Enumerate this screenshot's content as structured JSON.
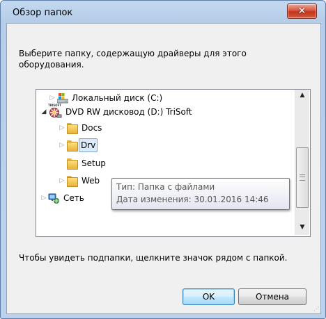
{
  "dialog": {
    "title": "Обзор папок",
    "close_glyph": "✕",
    "prompt": "Выберите папку, содержащую драйверы для этого оборудования.",
    "hint": "Чтобы увидеть подпапки, щелкните значок рядом с папкой.",
    "ok_label": "OK",
    "cancel_label": "Отмена"
  },
  "tree": {
    "items": [
      {
        "label": "Локальный диск (C:)",
        "icon": "hard-drive-icon",
        "expander": "collapsed"
      },
      {
        "label": "DVD RW дисковод (D:) TriSoft",
        "icon": "dvd-drive-icon",
        "expander": "expanded",
        "icon_caption": "TRISOFT"
      },
      {
        "label": "Docs",
        "icon": "folder-icon",
        "expander": "collapsed"
      },
      {
        "label": "Drv",
        "icon": "folder-icon",
        "expander": "collapsed",
        "selected": true
      },
      {
        "label": "Setup",
        "icon": "folder-icon",
        "expander": "none"
      },
      {
        "label": "Web",
        "icon": "folder-icon",
        "expander": "collapsed"
      },
      {
        "label": "Сеть",
        "icon": "network-icon",
        "expander": "collapsed"
      }
    ]
  },
  "tooltip": {
    "line1": "Тип: Папка с файлами",
    "line2": "Дата изменения: 30.01.2016 14:46"
  },
  "scrollbar": {
    "up_glyph": "▲",
    "down_glyph": "▼",
    "position_fraction": 0.45
  },
  "colors": {
    "selection_fill": "#dcebfc",
    "selection_border": "#7da2ce",
    "close_button": "#c2341c",
    "default_button_border": "#3c7fb1"
  }
}
